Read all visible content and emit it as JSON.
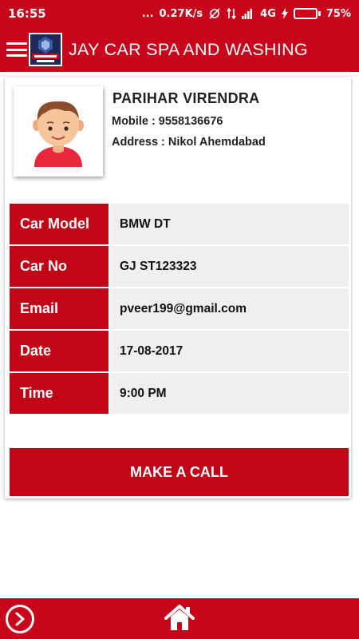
{
  "status_bar": {
    "time": "16:55",
    "dots": "...",
    "network_speed": "0.27K/s",
    "network_type": "4G",
    "battery_percent": "75%",
    "battery_level": 0.75
  },
  "app_bar": {
    "title": "JAY CAR SPA AND WASHING",
    "menu_icon": "hamburger-menu-icon",
    "logo_icon": "app-logo"
  },
  "customer": {
    "name": "PARIHAR VIRENDRA",
    "mobile_line": "Mobile : 9558136676",
    "address_line": "Address : Nikol Ahemdabad",
    "avatar_icon": "user-avatar"
  },
  "details": [
    {
      "label": "Car Model",
      "value": "BMW DT"
    },
    {
      "label": "Car No",
      "value": "GJ ST123323"
    },
    {
      "label": "Email",
      "value": "pveer199@gmail.com"
    },
    {
      "label": "Date",
      "value": "17-08-2017"
    },
    {
      "label": "Time",
      "value": "9:00 PM"
    }
  ],
  "call_button_label": "MAKE A CALL",
  "bottom_nav": {
    "next_icon": "chevron-right-circle-icon",
    "home_icon": "home-icon"
  },
  "colors": {
    "primary": "#c8051a",
    "label_bg": "#c20417",
    "value_bg": "#efefef"
  }
}
